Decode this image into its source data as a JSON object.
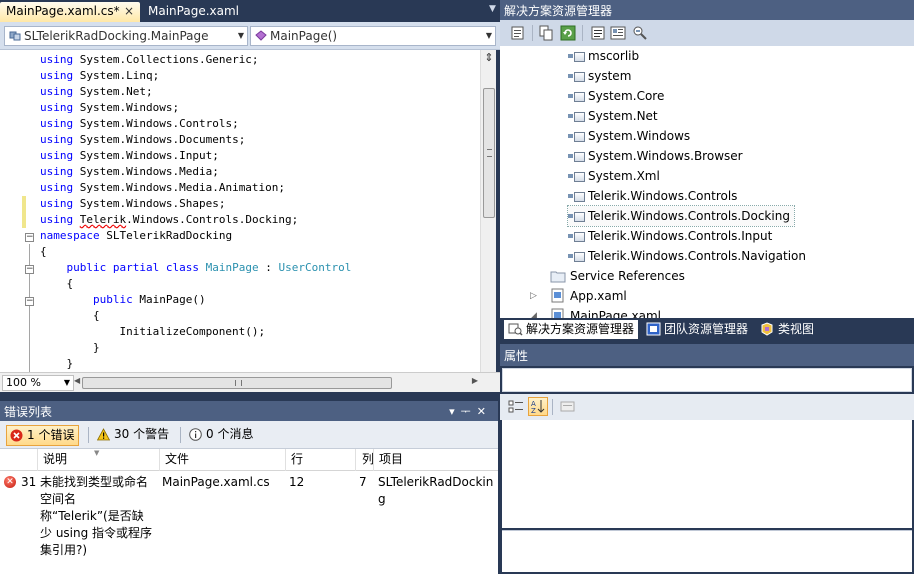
{
  "editor": {
    "tabs": [
      {
        "label": "MainPage.xaml.cs*",
        "active": true
      },
      {
        "label": "MainPage.xaml",
        "active": false
      }
    ],
    "close_glyph": "×",
    "type_combo": "SLTelerikRadDocking.MainPage",
    "member_combo": "MainPage()",
    "zoom": "100 %",
    "code_lines": [
      [
        {
          "t": "using",
          "c": "kw"
        },
        {
          "t": " System.Collections.Generic;"
        }
      ],
      [
        {
          "t": "using",
          "c": "kw"
        },
        {
          "t": " System.Linq;"
        }
      ],
      [
        {
          "t": "using",
          "c": "kw"
        },
        {
          "t": " System.Net;"
        }
      ],
      [
        {
          "t": "using",
          "c": "kw"
        },
        {
          "t": " System.Windows;"
        }
      ],
      [
        {
          "t": "using",
          "c": "kw"
        },
        {
          "t": " System.Windows.Controls;"
        }
      ],
      [
        {
          "t": "using",
          "c": "kw"
        },
        {
          "t": " System.Windows.Documents;"
        }
      ],
      [
        {
          "t": "using",
          "c": "kw"
        },
        {
          "t": " System.Windows.Input;"
        }
      ],
      [
        {
          "t": "using",
          "c": "kw"
        },
        {
          "t": " System.Windows.Media;"
        }
      ],
      [
        {
          "t": "using",
          "c": "kw"
        },
        {
          "t": " System.Windows.Media.Animation;"
        }
      ],
      [
        {
          "t": "using",
          "c": "kw"
        },
        {
          "t": " System.Windows.Shapes;"
        }
      ],
      [
        {
          "t": "using",
          "c": "kw"
        },
        {
          "t": " "
        },
        {
          "t": "Telerik",
          "c": "squig"
        },
        {
          "t": ".Windows.Controls.Docking;"
        }
      ],
      [
        {
          "t": "namespace",
          "c": "kw"
        },
        {
          "t": " SLTelerikRadDocking"
        }
      ],
      [
        {
          "t": "{"
        }
      ],
      [
        {
          "t": "    "
        },
        {
          "t": "public",
          "c": "kw"
        },
        {
          "t": " "
        },
        {
          "t": "partial",
          "c": "kw"
        },
        {
          "t": " "
        },
        {
          "t": "class",
          "c": "kw"
        },
        {
          "t": " "
        },
        {
          "t": "MainPage",
          "c": "ty"
        },
        {
          "t": " : "
        },
        {
          "t": "UserControl",
          "c": "ty"
        }
      ],
      [
        {
          "t": "    {"
        }
      ],
      [
        {
          "t": "        "
        },
        {
          "t": "public",
          "c": "kw"
        },
        {
          "t": " MainPage()"
        }
      ],
      [
        {
          "t": "        {"
        }
      ],
      [
        {
          "t": "            InitializeComponent();"
        }
      ],
      [
        {
          "t": "        }"
        }
      ],
      [
        {
          "t": "    }"
        }
      ]
    ]
  },
  "error_list": {
    "title": "错误列表",
    "filters": {
      "errors": "1 个错误",
      "warnings": "30 个警告",
      "messages": "0 个消息"
    },
    "columns": {
      "description": "说明",
      "file": "文件",
      "line": "行",
      "column": "列",
      "project": "项目"
    },
    "rows": [
      {
        "index": "31",
        "description_lines": [
          "未能找到类型或命名",
          "空间名",
          "称“Telerik”(是否缺",
          "少 using 指令或程序",
          "集引用?)"
        ],
        "file": "MainPage.xaml.cs",
        "line": "12",
        "column": "7",
        "project_lines": [
          "SLTelerikRadDockin",
          "g"
        ]
      }
    ]
  },
  "solution_explorer": {
    "title": "解决方案资源管理器",
    "references": [
      "mscorlib",
      "system",
      "System.Core",
      "System.Net",
      "System.Windows",
      "System.Windows.Browser",
      "System.Xml",
      "Telerik.Windows.Controls",
      "Telerik.Windows.Controls.Docking",
      "Telerik.Windows.Controls.Input",
      "Telerik.Windows.Controls.Navigation"
    ],
    "selected": "Telerik.Windows.Controls.Docking",
    "service_references": "Service References",
    "app_xaml": "App.xaml",
    "main_page": "MainPage.xaml",
    "bottom_tabs": [
      "解决方案资源管理器",
      "团队资源管理器",
      "类视图"
    ]
  },
  "properties": {
    "title": "属性"
  },
  "colors": {
    "chrome": "#293955",
    "pane_header": "#4d6082",
    "keyword": "#0000ff",
    "type": "#2b91af"
  }
}
